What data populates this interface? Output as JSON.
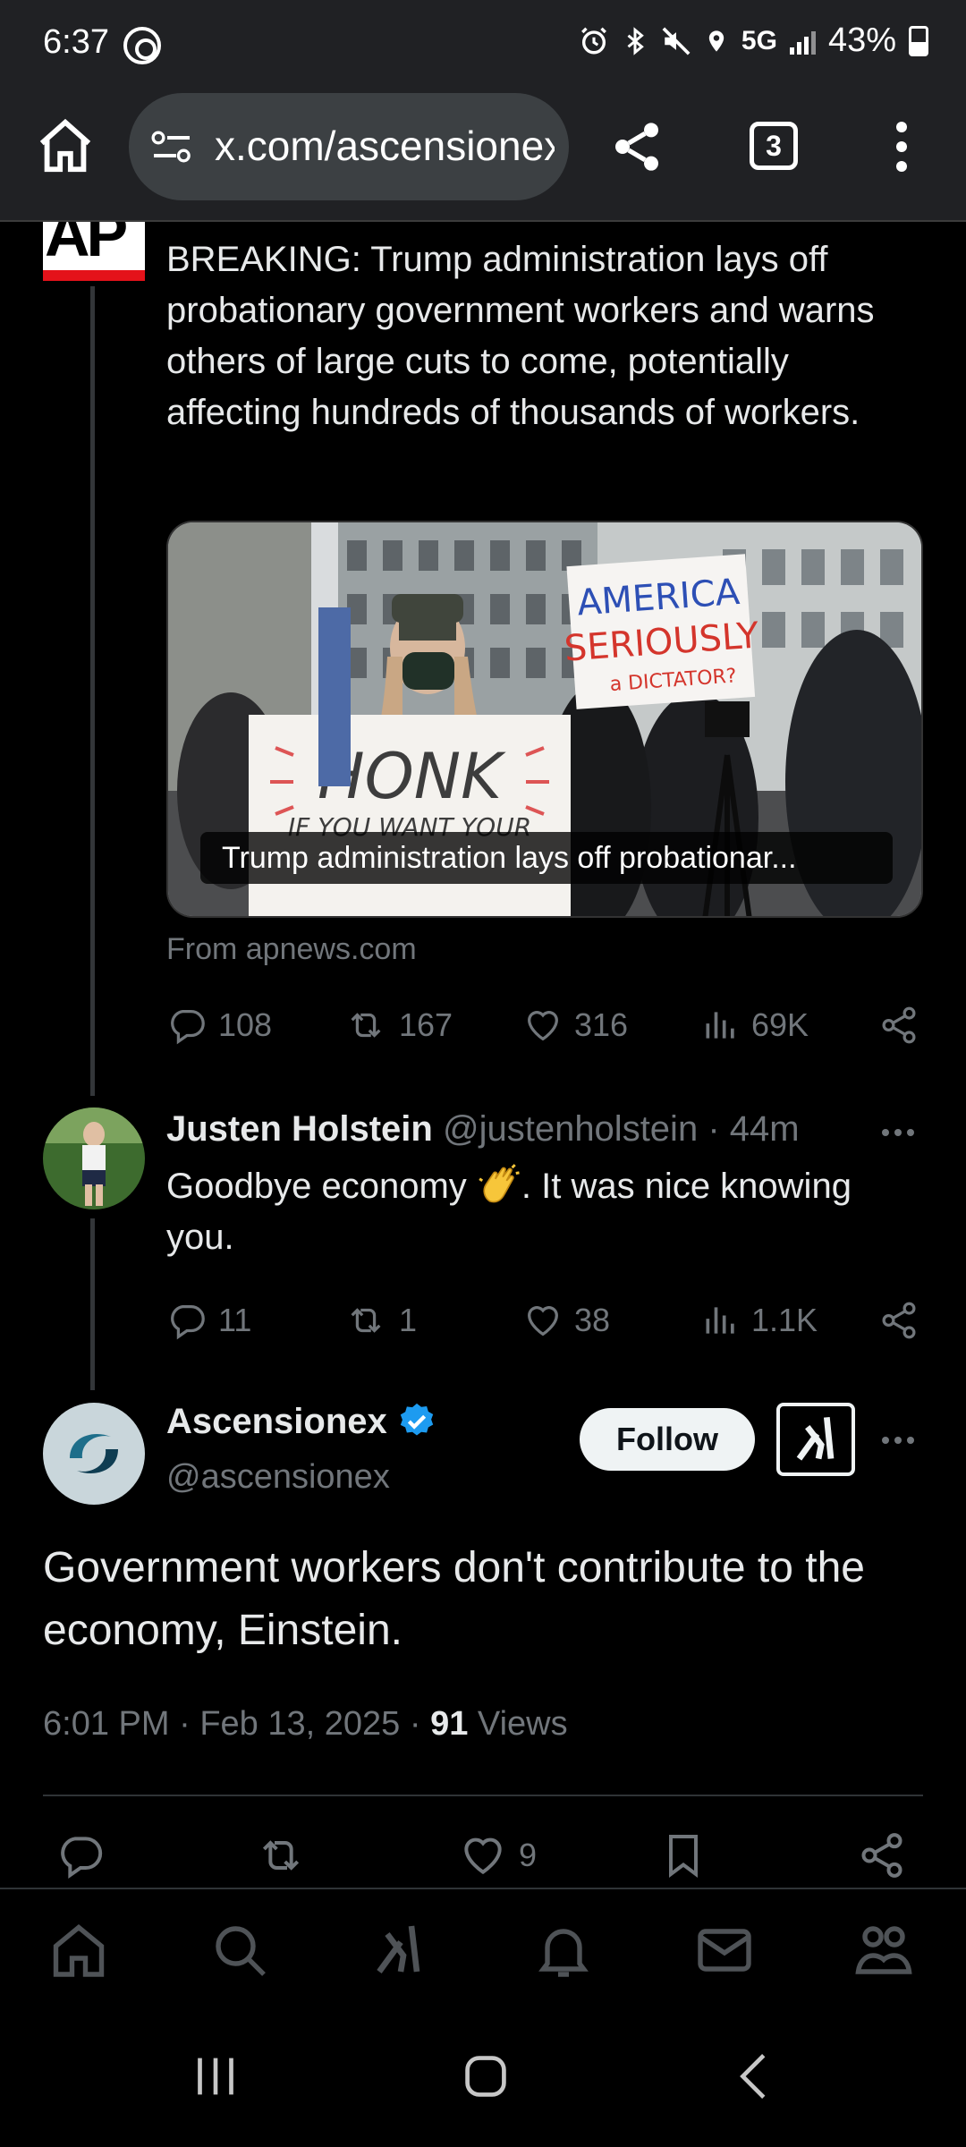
{
  "status_bar": {
    "time": "6:37",
    "network": "5G",
    "battery": "43%",
    "icons": [
      "threads-icon",
      "alarm-icon",
      "bluetooth-icon",
      "mute-icon",
      "location-icon",
      "signal-icon",
      "battery-icon"
    ]
  },
  "browser": {
    "url": "x.com/ascensionex",
    "tab_count": "3",
    "icons": [
      "home-icon",
      "site-settings-icon",
      "share-icon",
      "more-vert-icon"
    ]
  },
  "quoted_post": {
    "source_logo": "AP",
    "text": "BREAKING: Trump administration lays off probationary government workers and warns others of large cuts to come, potentially affecting hundreds of thousands of workers.",
    "card_caption": "Trump administration lays off probationar...",
    "card_image_text": {
      "sign_left_main": "HONK",
      "sign_left_sub": "IF YOU WANT YOUR",
      "sign_right_line1": "AMERICA",
      "sign_right_line2": "SERIOUSLY",
      "sign_right_line3": "a DICTATOR?"
    },
    "source": "From apnews.com",
    "stats": {
      "replies": "108",
      "reposts": "167",
      "likes": "316",
      "views": "69K"
    }
  },
  "reply": {
    "name": "Justen Holstein",
    "handle": "@justenholstein",
    "time": "44m",
    "text_before": "Goodbye economy ",
    "text_after": ". It was nice knowing you.",
    "stats": {
      "replies": "11",
      "reposts": "1",
      "likes": "38",
      "views": "1.1K"
    }
  },
  "main_post": {
    "name": "Ascensionex",
    "handle": "@ascensionex",
    "follow_label": "Follow",
    "text": "Government workers don't contribute to the economy, Einstein.",
    "time": "6:01 PM",
    "date": "Feb 13, 2025",
    "views_count": "91",
    "views_label": "Views",
    "likes": "9"
  },
  "bottom_nav": [
    "home-icon",
    "search-icon",
    "grok-icon",
    "notifications-icon",
    "messages-icon",
    "communities-icon"
  ],
  "colors": {
    "background": "#000000",
    "chrome_bar": "#202124",
    "text_primary": "#e7e9ea",
    "text_secondary": "#71767b",
    "verified_blue": "#1d9bf0",
    "ap_red": "#e4121a"
  }
}
